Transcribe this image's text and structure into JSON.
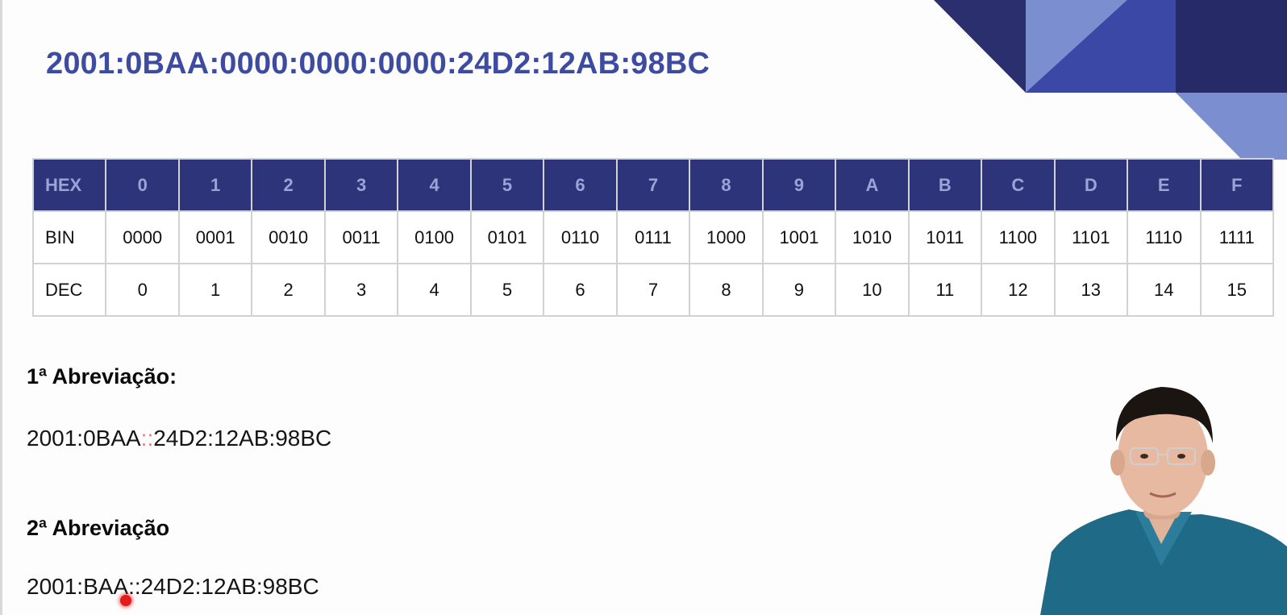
{
  "slide": {
    "title": "2001:0BAA:0000:0000:0000:24D2:12AB:98BC"
  },
  "table": {
    "header_label": "HEX",
    "columns": [
      "0",
      "1",
      "2",
      "3",
      "4",
      "5",
      "6",
      "7",
      "8",
      "9",
      "A",
      "B",
      "C",
      "D",
      "E",
      "F"
    ],
    "rows": [
      {
        "label": "BIN",
        "values": [
          "0000",
          "0001",
          "0010",
          "0011",
          "0100",
          "0101",
          "0110",
          "0111",
          "1000",
          "1001",
          "1010",
          "1011",
          "1100",
          "1101",
          "1110",
          "1111"
        ]
      },
      {
        "label": "DEC",
        "values": [
          "0",
          "1",
          "2",
          "3",
          "4",
          "5",
          "6",
          "7",
          "8",
          "9",
          "10",
          "11",
          "12",
          "13",
          "14",
          "15"
        ]
      }
    ]
  },
  "abbreviation1": {
    "heading": "1ª Abreviação:",
    "address_prefix": "2001:0BAA",
    "separator": "::",
    "address_suffix": "24D2:12AB:98BC"
  },
  "abbreviation2": {
    "heading": "2ª Abreviação",
    "address": "2001:BAA::24D2:12AB:98BC"
  },
  "colors": {
    "title": "#3d4ca0",
    "table_header_bg": "#2e3479",
    "table_header_text": "#9ca3d6",
    "separator_highlight": "#f08080",
    "pointer": "#e31b1b"
  },
  "icons": {
    "pointer": "laser-pointer-dot",
    "presenter": "presenter-webcam"
  }
}
